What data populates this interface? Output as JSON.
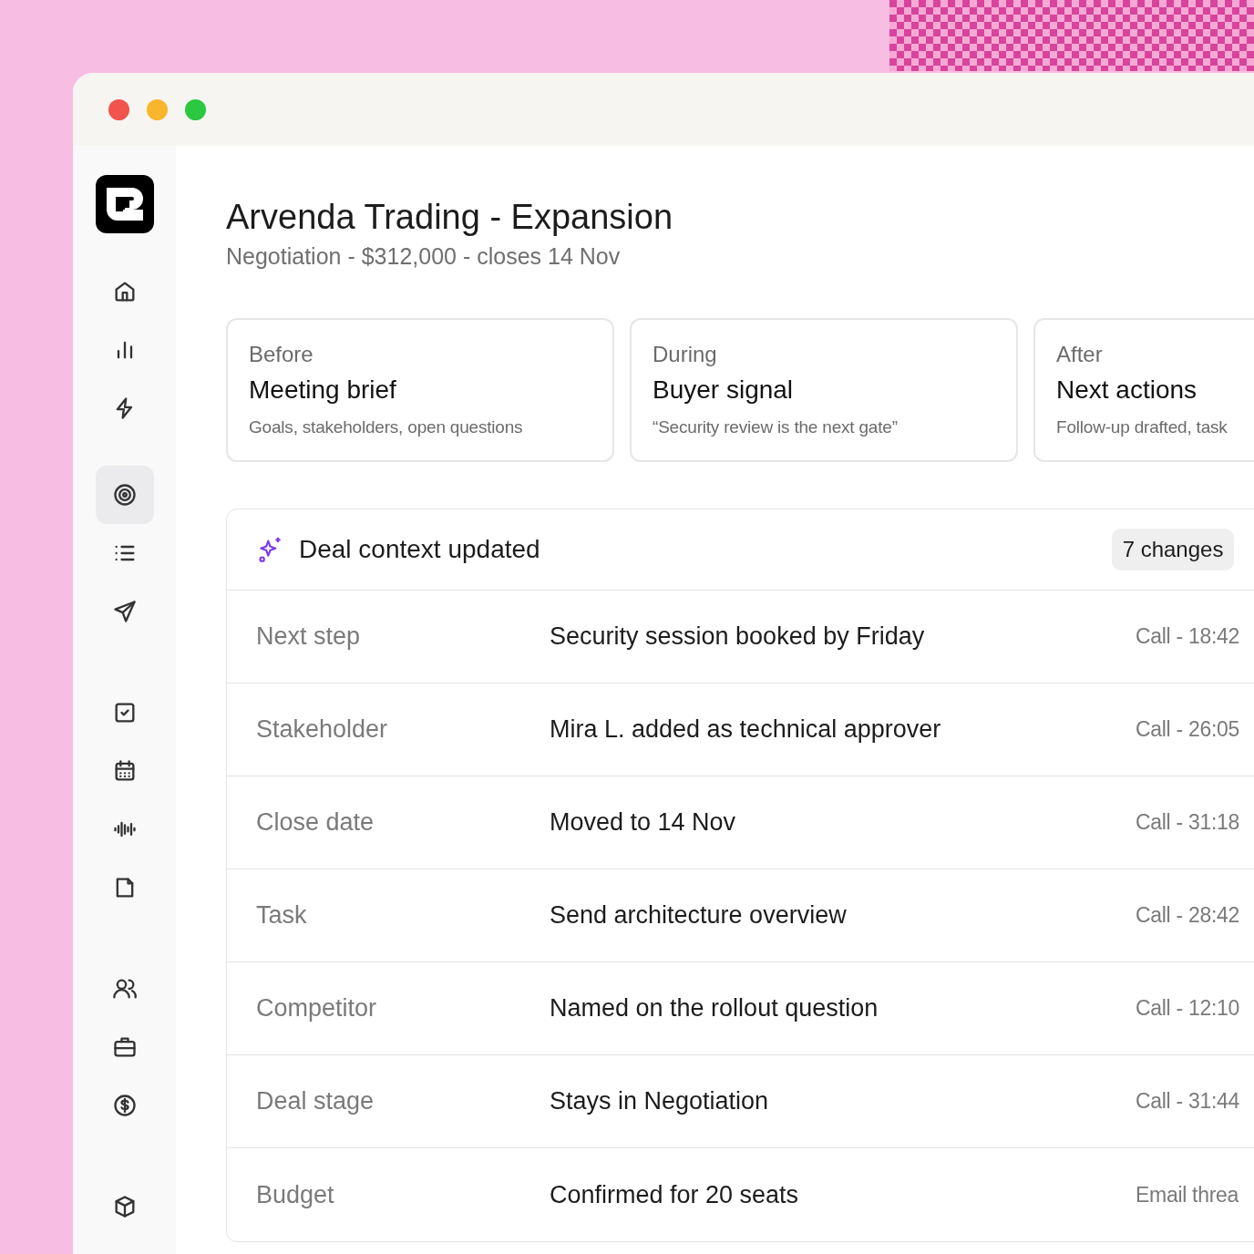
{
  "sidebar": {
    "groups": [
      {
        "items": [
          {
            "selected": false
          },
          {
            "selected": false
          },
          {
            "selected": false
          }
        ]
      },
      {
        "items": [
          {
            "selected": true
          },
          {
            "selected": false
          },
          {
            "selected": false
          }
        ]
      },
      {
        "items": [
          {
            "selected": false
          },
          {
            "selected": false
          },
          {
            "selected": false
          },
          {
            "selected": false
          }
        ]
      },
      {
        "items": [
          {
            "selected": false
          },
          {
            "selected": false
          },
          {
            "selected": false
          }
        ]
      },
      {
        "items": [
          {
            "selected": false
          }
        ]
      }
    ]
  },
  "deal": {
    "title": "Arvenda Trading - Expansion",
    "subtitle": "Negotiation - $312,000 - closes 14 Nov"
  },
  "cards": [
    {
      "phase": "Before",
      "title": "Meeting brief",
      "detail": "Goals, stakeholders, open questions"
    },
    {
      "phase": "During",
      "title": "Buyer signal",
      "detail": "“Security review is the next gate”"
    },
    {
      "phase": "After",
      "title": "Next actions",
      "detail": "Follow-up drafted, task"
    }
  ],
  "panel": {
    "title": "Deal context updated",
    "badge": "7 changes",
    "rows": [
      {
        "field": "Next step",
        "value": "Security session booked by Friday",
        "source": "Call - 18:42"
      },
      {
        "field": "Stakeholder",
        "value": "Mira L. added as technical approver",
        "source": "Call - 26:05"
      },
      {
        "field": "Close date",
        "value": "Moved to 14 Nov",
        "source": "Call - 31:18"
      },
      {
        "field": "Task",
        "value": "Send architecture overview",
        "source": "Call - 28:42"
      },
      {
        "field": "Competitor",
        "value": "Named on the rollout question",
        "source": "Call - 12:10"
      },
      {
        "field": "Deal stage",
        "value": "Stays in Negotiation",
        "source": "Call - 31:44"
      },
      {
        "field": "Budget",
        "value": "Confirmed for 20 seats",
        "source": "Email threa"
      }
    ]
  }
}
